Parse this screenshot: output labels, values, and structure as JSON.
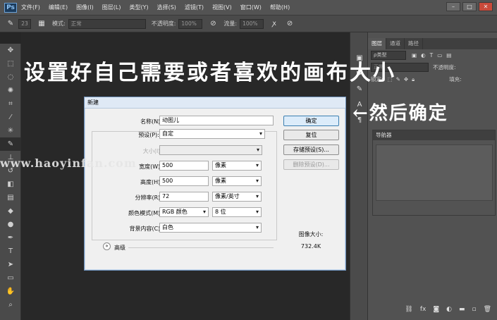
{
  "app": {
    "logo": "Ps"
  },
  "menu": [
    "文件(F)",
    "编辑(E)",
    "图像(I)",
    "图层(L)",
    "类型(Y)",
    "选择(S)",
    "滤镜(T)",
    "视图(V)",
    "窗口(W)",
    "帮助(H)"
  ],
  "options_bar": {
    "brush_size": "23",
    "mode_label": "模式:",
    "mode_value": "正常",
    "opacity_label": "不透明度:",
    "opacity_value": "100%",
    "flow_label": "流量:",
    "flow_value": "100%"
  },
  "annotations": {
    "main": "设置好自己需要或者喜欢的画布大小",
    "side": "←然后确定",
    "watermark": "www.haoyinfan.com"
  },
  "right_panel": {
    "tabs": [
      "图层",
      "通道",
      "路径"
    ],
    "kind_label": "ρ类型",
    "blend_value": "正常",
    "opacity_label": "不透明度:",
    "lock_label": "锁定:",
    "fill_label": "填充:",
    "navigator_title": "导航器"
  },
  "dialog": {
    "title": "新建",
    "name_label": "名称(N):",
    "name_value": "动图儿",
    "preset_label": "预设(P):",
    "preset_value": "自定",
    "size_label": "大小(I):",
    "width_label": "宽度(W):",
    "width_value": "500",
    "width_unit": "像素",
    "height_label": "高度(H):",
    "height_value": "500",
    "height_unit": "像素",
    "resolution_label": "分辨率(R):",
    "resolution_value": "72",
    "resolution_unit": "像素/英寸",
    "color_mode_label": "颜色模式(M):",
    "color_mode_value": "RGB 颜色",
    "bit_depth_value": "8 位",
    "background_label": "背景内容(C):",
    "background_value": "白色",
    "advanced_label": "高级",
    "image_size_label": "图像大小:",
    "image_size_value": "732.4K",
    "ok_button": "确定",
    "reset_button": "复位",
    "save_preset_button": "存储预设(S)...",
    "delete_preset_button": "删除预设(D)..."
  }
}
